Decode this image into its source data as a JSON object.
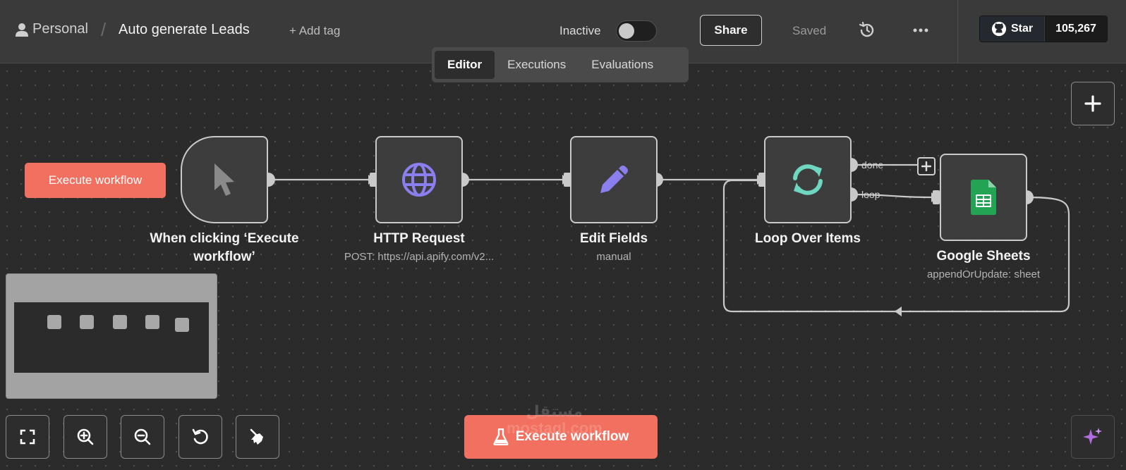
{
  "header": {
    "project": "Personal",
    "workflow_name": "Auto generate Leads",
    "add_tag": "+ Add tag",
    "status_label": "Inactive",
    "share_label": "Share",
    "saved_label": "Saved",
    "github_star_label": "Star",
    "github_star_count": "105,267"
  },
  "tabs": [
    {
      "label": "Editor",
      "active": true
    },
    {
      "label": "Executions",
      "active": false
    },
    {
      "label": "Evaluations",
      "active": false
    }
  ],
  "canvas": {
    "side_execute_label": "Execute workflow",
    "nodes": [
      {
        "title": "When clicking ‘Execute workflow’",
        "subtitle": "",
        "icon": "cursor-icon"
      },
      {
        "title": "HTTP Request",
        "subtitle": "POST: https://api.apify.com/v2...",
        "icon": "globe-icon"
      },
      {
        "title": "Edit Fields",
        "subtitle": "manual",
        "icon": "pencil-icon"
      },
      {
        "title": "Loop Over Items",
        "subtitle": "",
        "icon": "loop-icon"
      },
      {
        "title": "Google Sheets",
        "subtitle": "appendOrUpdate: sheet",
        "icon": "google-sheets-icon"
      }
    ],
    "edge_labels": {
      "done": "done",
      "loop": "loop"
    }
  },
  "footer": {
    "execute_label": "Execute workflow",
    "watermark_arabic": "مستقل",
    "watermark_latin": "mostaql.com"
  },
  "colors": {
    "accent": "#f2705f",
    "globe": "#8b7ff0",
    "pencil": "#8b7ff0",
    "loop": "#6fd6bf",
    "sheets": "#23a455"
  }
}
